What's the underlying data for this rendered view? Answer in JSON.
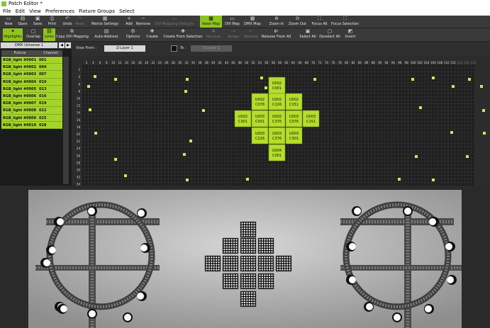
{
  "window": {
    "title": "Patch Editor *"
  },
  "menu": [
    "File",
    "Edit",
    "View",
    "Preferences",
    "Fixture Groups",
    "Select"
  ],
  "toolbar1": [
    {
      "label": "New",
      "icon": "new-icon",
      "glyph": "▭",
      "state": "normal"
    },
    {
      "label": "Open",
      "icon": "open-icon",
      "glyph": "▤",
      "state": "normal"
    },
    {
      "label": "Save",
      "icon": "save-icon",
      "glyph": "▣",
      "state": "normal"
    },
    {
      "label": "Print",
      "icon": "print-icon",
      "glyph": "⎙",
      "state": "normal"
    },
    {
      "label": "Undo",
      "icon": "undo-icon",
      "glyph": "↶",
      "state": "normal"
    },
    {
      "label": "Redo",
      "icon": "redo-icon",
      "glyph": "↷",
      "state": "disabled"
    },
    {
      "label": "Matrix Settings",
      "icon": "matrix-settings-icon",
      "glyph": "▦",
      "state": "normal"
    },
    {
      "label": "Add",
      "icon": "add-icon",
      "glyph": "+",
      "state": "normal"
    },
    {
      "label": "Remove",
      "icon": "remove-icon",
      "glyph": "−",
      "state": "normal"
    },
    {
      "label": "DVI Mapping Defaults",
      "icon": "dvi-defaults-icon",
      "glyph": "▭",
      "state": "disabled"
    },
    {
      "label": "Voxel Map",
      "icon": "voxel-map-icon",
      "glyph": "▦",
      "state": "active"
    },
    {
      "label": "DVI Map",
      "icon": "dvi-map-icon",
      "glyph": "▭",
      "state": "normal"
    },
    {
      "label": "DMX Map",
      "icon": "dmx-map-icon",
      "glyph": "▦",
      "state": "normal"
    },
    {
      "label": "Zoom In",
      "icon": "zoom-in-icon",
      "glyph": "⊕",
      "state": "normal"
    },
    {
      "label": "Zoom Out",
      "icon": "zoom-out-icon",
      "glyph": "⊖",
      "state": "normal"
    },
    {
      "label": "Focus All",
      "icon": "focus-all-icon",
      "glyph": "⛶",
      "state": "normal"
    },
    {
      "label": "Focus Selection",
      "icon": "focus-selection-icon",
      "glyph": "⛶",
      "state": "normal"
    }
  ],
  "toolbar2": [
    {
      "label": "Highlights",
      "icon": "highlights-icon",
      "glyph": "✦",
      "state": "active"
    },
    {
      "label": "Overlap",
      "icon": "overlap-icon",
      "glyph": "▢",
      "state": "normal"
    },
    {
      "label": "Links",
      "icon": "links-icon",
      "glyph": "⛓",
      "state": "active"
    },
    {
      "label": "Copy DVI Mapping",
      "icon": "copy-dvi-icon",
      "glyph": "⧉",
      "state": "normal"
    },
    {
      "label": "Auto-Address",
      "icon": "auto-address-icon",
      "glyph": "▤",
      "state": "normal"
    },
    {
      "label": "Options",
      "icon": "options-icon",
      "glyph": "⚙",
      "state": "normal"
    },
    {
      "label": "Create",
      "icon": "create-icon",
      "glyph": "✚",
      "state": "normal"
    },
    {
      "label": "Create From Selection",
      "icon": "create-from-selection-icon",
      "glyph": "✚",
      "state": "normal"
    },
    {
      "label": "Remove",
      "icon": "remove-group-icon",
      "glyph": "✖",
      "state": "disabled"
    },
    {
      "label": "Assign",
      "icon": "assign-icon",
      "glyph": "→",
      "state": "disabled"
    },
    {
      "label": "Release",
      "icon": "release-icon",
      "glyph": "←",
      "state": "disabled"
    },
    {
      "label": "Release From All",
      "icon": "release-all-icon",
      "glyph": "⇇",
      "state": "normal"
    },
    {
      "label": "Select All",
      "icon": "select-all-icon",
      "glyph": "▣",
      "state": "normal"
    },
    {
      "label": "Deselect All",
      "icon": "deselect-all-icon",
      "glyph": "▢",
      "state": "normal"
    },
    {
      "label": "Invert",
      "icon": "invert-icon",
      "glyph": "◩",
      "state": "normal"
    }
  ],
  "universe": {
    "selected": "DMX Universe 1",
    "prev_glyph": "◀",
    "next_glyph": "▶"
  },
  "fixture_table": {
    "headers": [
      "Fixture",
      "Channel"
    ],
    "rows": [
      {
        "fixture": "RGB_light #0001",
        "channel": "001"
      },
      {
        "fixture": "RGB_light #0002",
        "channel": "004"
      },
      {
        "fixture": "RGB_light #0003",
        "channel": "007"
      },
      {
        "fixture": "RGB_light #0004",
        "channel": "010"
      },
      {
        "fixture": "RGB_light #0005",
        "channel": "013"
      },
      {
        "fixture": "RGB_light #0006",
        "channel": "016"
      },
      {
        "fixture": "RGB_light #0007",
        "channel": "019"
      },
      {
        "fixture": "RGB_light #0008",
        "channel": "022"
      },
      {
        "fixture": "RGB_light #0009",
        "channel": "025"
      },
      {
        "fixture": "RGB_light #0010",
        "channel": "028"
      }
    ]
  },
  "view_bar": {
    "view_from_label": "View From :",
    "view_from_value": "Z-Layer 1",
    "to_label": "To :",
    "to_value": "Z-Layer 1"
  },
  "matrix": {
    "x_labels": [
      "2",
      "4",
      "6",
      "8",
      "10",
      "12",
      "14",
      "16",
      "18",
      "20",
      "22",
      "24",
      "26",
      "28",
      "30",
      "32",
      "34",
      "36",
      "38",
      "40",
      "42",
      "44",
      "46",
      "48",
      "50",
      "52",
      "54",
      "56",
      "58",
      "60",
      "62",
      "64",
      "66",
      "68",
      "70",
      "72",
      "74",
      "76",
      "78",
      "80",
      "82",
      "84",
      "86",
      "88",
      "90",
      "92",
      "94",
      "96",
      "98",
      "100",
      "102",
      "104",
      "106",
      "108",
      "110",
      "112",
      "114",
      "116",
      "118"
    ],
    "y_labels": [
      "2",
      "4",
      "6",
      "8",
      "10",
      "12",
      "14",
      "16",
      "18",
      "20",
      "22",
      "24",
      "26",
      "28",
      "30",
      "32",
      "34"
    ],
    "blocks": [
      {
        "line1": "U002",
        "line2": "C001"
      },
      {
        "line1": "U002",
        "line2": "C078"
      },
      {
        "line1": "U002",
        "line2": "C226"
      },
      {
        "line1": "U002",
        "line2": "C151"
      },
      {
        "line1": "U002",
        "line2": "C301"
      },
      {
        "line1": "U003",
        "line2": "C001"
      },
      {
        "line1": "U002",
        "line2": "C376"
      },
      {
        "line1": "U003",
        "line2": "C076"
      },
      {
        "line1": "U003",
        "line2": "C151"
      },
      {
        "line1": "U003",
        "line2": "C226"
      },
      {
        "line1": "U003",
        "line2": "C376"
      },
      {
        "line1": "U003",
        "line2": "C301"
      },
      {
        "line1": "U004",
        "line2": "C001"
      }
    ]
  },
  "colors": {
    "accent": "#a4d42a",
    "block": "#b5dd2a",
    "grid_bg": "#1f1f1f",
    "grid_line": "#3a3a3a",
    "fixture_dot": "#c8e860",
    "preview_bg": "#b8b8b8"
  }
}
